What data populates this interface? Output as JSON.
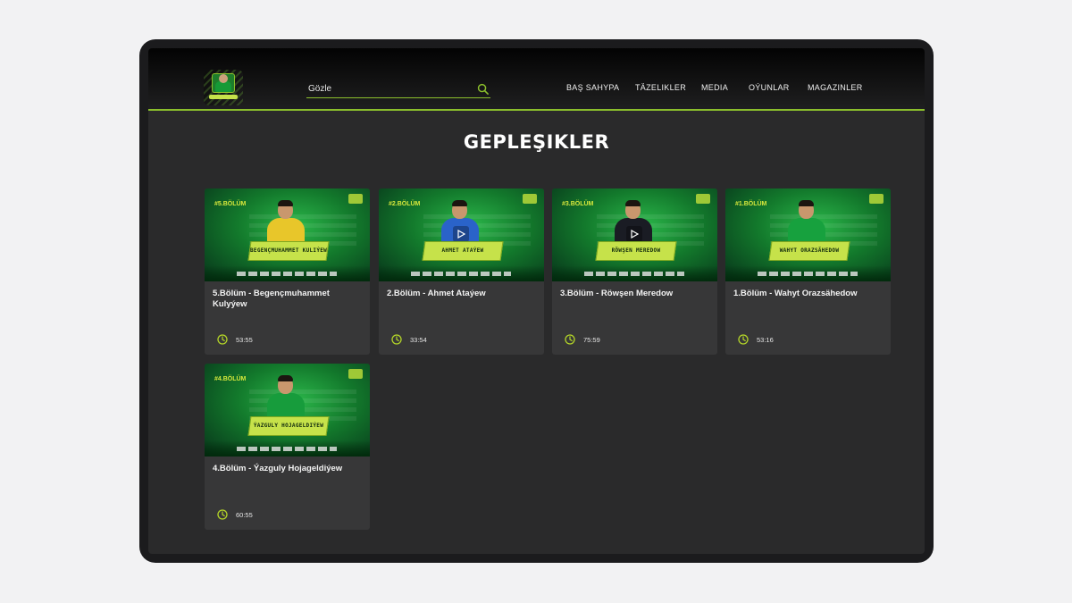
{
  "header": {
    "logo_name": "site-logo",
    "search": {
      "placeholder": "Gözle",
      "icon": "search-icon"
    },
    "nav": [
      "BAŞ SAHYPA",
      "TÄZELIKLER",
      "MEDIA",
      "OÝUNLAR",
      "MAGAZINLER"
    ]
  },
  "page": {
    "title": "GEPLEŞIKLER"
  },
  "colors": {
    "accent": "#8bbf2c",
    "background": "#2a2a2b",
    "card": "#373738",
    "clock": "#b5d728"
  },
  "episodes": [
    {
      "title": "5.Bölüm - Begençmuhammet Kulyýew",
      "duration": "53:55",
      "thumb_episode": "#5.BÖLÜM",
      "thumb_name": "BEGENÇMUHAMMET KULIÝEW",
      "shirt": "#e8c62a"
    },
    {
      "title": "2.Bölüm - Ahmet Ataýew",
      "duration": "33:54",
      "thumb_episode": "#2.BÖLÜM",
      "thumb_name": "AHMET ATAÝEW",
      "shirt": "#2a63c9"
    },
    {
      "title": "3.Bölüm - Röwşen Meredow",
      "duration": "75:59",
      "thumb_episode": "#3.BÖLÜM",
      "thumb_name": "RÖWŞEN MEREDOW",
      "shirt": "#1a1c24"
    },
    {
      "title": "1.Bölüm - Wahyt Orazsähedow",
      "duration": "53:16",
      "thumb_episode": "#1.BÖLÜM",
      "thumb_name": "WAHYT ORAZSÄHEDOW",
      "shirt": "#17a13e"
    },
    {
      "title": "4.Bölüm - Ýazguly Hojageldiýew",
      "duration": "60:55",
      "thumb_episode": "#4.BÖLÜM",
      "thumb_name": "ÝAZGULY HOJAGELDIÝEW",
      "shirt": "#179c3c"
    }
  ]
}
